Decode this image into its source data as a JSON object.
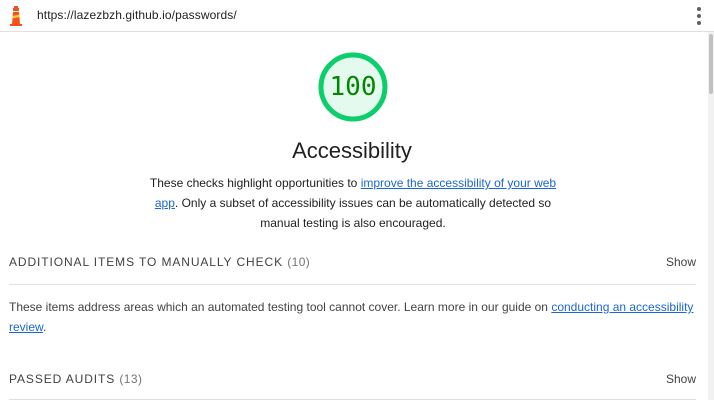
{
  "browser": {
    "url": "https://lazezbzh.github.io/passwords/",
    "menu_icon": "vertical-dots-icon",
    "logo_icon": "lighthouse-icon"
  },
  "gauge": {
    "score": "100",
    "score_fraction": 1.0,
    "color": "#0cce6b",
    "text_color": "#008800"
  },
  "category": {
    "title": "Accessibility",
    "description_prefix": "These checks highlight opportunities to ",
    "description_link": "improve the accessibility of your web app",
    "description_suffix": ". Only a subset of accessibility issues can be automatically detected so manual testing is also encouraged."
  },
  "manual_group": {
    "title": "ADDITIONAL ITEMS TO MANUALLY CHECK",
    "count": "(10)",
    "show_label": "Show",
    "description_prefix": "These items address areas which an automated testing tool cannot cover. Learn more in our guide on ",
    "description_link": "conducting an accessibility review",
    "description_suffix": "."
  },
  "passed_group": {
    "title": "PASSED AUDITS",
    "count": "(13)",
    "show_label": "Show"
  },
  "colors": {
    "link": "#1967d2",
    "divider": "#e0e0e0"
  }
}
